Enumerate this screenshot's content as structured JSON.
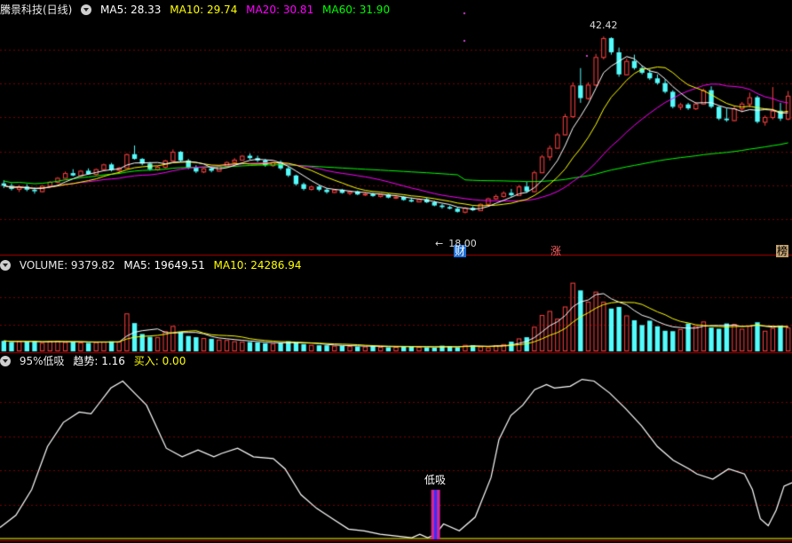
{
  "header_price": {
    "title": "騰景科技(日线)",
    "ma5": "MA5: 28.33",
    "ma10": "MA10: 29.74",
    "ma20": "MA20: 30.81",
    "ma60": "MA60: 31.90"
  },
  "header_volume": {
    "volume": "VOLUME: 9379.82",
    "ma5": "MA5: 19649.51",
    "ma10": "MA10: 24286.94"
  },
  "header_indicator": {
    "name": "95%低吸",
    "trend": "趋势: 1.16",
    "buy": "买入: 0.00"
  },
  "annotations": {
    "high_label": "42.42",
    "low_label": "18.00",
    "buy_signal": "低吸",
    "event_cai": "财",
    "event_zhang": "涨",
    "event_bang": "榜"
  },
  "colors": {
    "up": "#ff4040",
    "down": "#54fcfc",
    "ma5": "#ffffff",
    "ma10": "#ffff00",
    "ma20": "#ff00ff",
    "ma60": "#00ff00",
    "grid": "#7a0000"
  },
  "chart_data": {
    "type": "candlestick",
    "panels": [
      "price",
      "volume",
      "trend"
    ],
    "price_range": [
      15,
      45
    ],
    "candles": [
      [
        23.8,
        24.2,
        23.2,
        23.5
      ],
      [
        23.5,
        23.8,
        22.9,
        23.1
      ],
      [
        23.1,
        23.6,
        22.7,
        23.4
      ],
      [
        23.4,
        23.7,
        22.8,
        23.0
      ],
      [
        23.0,
        23.3,
        22.5,
        22.8
      ],
      [
        22.8,
        23.6,
        22.7,
        23.5
      ],
      [
        23.5,
        24.1,
        23.4,
        24.0
      ],
      [
        24.0,
        24.6,
        23.8,
        24.5
      ],
      [
        24.5,
        25.3,
        24.4,
        25.1
      ],
      [
        25.1,
        25.6,
        24.7,
        24.8
      ],
      [
        24.8,
        25.5,
        24.6,
        25.4
      ],
      [
        25.4,
        25.7,
        24.9,
        25.0
      ],
      [
        25.0,
        25.7,
        24.8,
        25.6
      ],
      [
        25.6,
        26.3,
        25.4,
        26.2
      ],
      [
        26.2,
        26.4,
        25.3,
        25.5
      ],
      [
        25.5,
        25.9,
        25.0,
        25.8
      ],
      [
        25.8,
        27.6,
        25.7,
        27.5
      ],
      [
        27.5,
        28.6,
        26.8,
        26.9
      ],
      [
        26.9,
        27.0,
        26.1,
        26.3
      ],
      [
        26.3,
        26.5,
        25.4,
        25.6
      ],
      [
        25.6,
        26.0,
        25.4,
        25.9
      ],
      [
        25.9,
        26.8,
        25.7,
        26.7
      ],
      [
        26.7,
        28.1,
        26.6,
        27.8
      ],
      [
        27.8,
        27.9,
        26.5,
        26.7
      ],
      [
        26.7,
        26.9,
        25.6,
        25.8
      ],
      [
        25.8,
        26.1,
        25.1,
        25.3
      ],
      [
        25.3,
        25.8,
        25.1,
        25.7
      ],
      [
        25.7,
        26.0,
        25.2,
        25.4
      ],
      [
        25.4,
        26.1,
        25.3,
        26.0
      ],
      [
        26.0,
        26.6,
        25.8,
        26.5
      ],
      [
        26.5,
        27.0,
        26.3,
        26.8
      ],
      [
        26.8,
        27.4,
        26.7,
        27.3
      ],
      [
        27.3,
        27.6,
        26.8,
        27.0
      ],
      [
        27.0,
        27.3,
        26.5,
        26.7
      ],
      [
        26.7,
        26.9,
        25.9,
        26.1
      ],
      [
        26.1,
        26.6,
        25.9,
        26.5
      ],
      [
        26.5,
        26.7,
        25.5,
        25.7
      ],
      [
        25.7,
        25.9,
        24.6,
        24.8
      ],
      [
        24.8,
        24.9,
        23.5,
        23.7
      ],
      [
        23.7,
        23.9,
        22.9,
        23.1
      ],
      [
        23.1,
        23.5,
        22.9,
        23.4
      ],
      [
        23.4,
        23.6,
        22.8,
        23.0
      ],
      [
        23.0,
        23.2,
        22.5,
        22.7
      ],
      [
        22.7,
        23.1,
        22.6,
        23.0
      ],
      [
        23.0,
        23.1,
        22.5,
        22.6
      ],
      [
        22.6,
        22.9,
        22.3,
        22.8
      ],
      [
        22.8,
        22.9,
        22.3,
        22.4
      ],
      [
        22.4,
        22.7,
        22.2,
        22.5
      ],
      [
        22.5,
        22.6,
        22.1,
        22.2
      ],
      [
        22.2,
        22.5,
        22.0,
        22.4
      ],
      [
        22.4,
        22.5,
        21.9,
        22.0
      ],
      [
        22.0,
        22.3,
        21.8,
        22.1
      ],
      [
        22.1,
        22.2,
        21.6,
        21.7
      ],
      [
        21.7,
        22.0,
        21.4,
        21.5
      ],
      [
        21.5,
        21.9,
        21.4,
        21.8
      ],
      [
        21.8,
        22.0,
        21.3,
        21.4
      ],
      [
        21.4,
        21.6,
        20.9,
        21.0
      ],
      [
        21.0,
        21.2,
        20.6,
        20.8
      ],
      [
        20.8,
        21.0,
        20.5,
        20.6
      ],
      [
        20.6,
        20.8,
        20.1,
        20.2
      ],
      [
        20.2,
        20.8,
        20.0,
        20.7
      ],
      [
        20.7,
        20.9,
        20.3,
        20.4
      ],
      [
        20.4,
        21.3,
        20.3,
        21.2
      ],
      [
        21.2,
        22.0,
        21.0,
        21.9
      ],
      [
        21.9,
        22.4,
        21.7,
        22.2
      ],
      [
        22.2,
        22.8,
        22.0,
        22.6
      ],
      [
        22.6,
        23.1,
        22.1,
        22.3
      ],
      [
        22.3,
        23.6,
        22.2,
        23.4
      ],
      [
        23.4,
        24.0,
        22.6,
        22.8
      ],
      [
        22.8,
        25.4,
        22.7,
        25.2
      ],
      [
        25.2,
        27.4,
        25.1,
        27.2
      ],
      [
        27.2,
        28.6,
        26.7,
        28.3
      ],
      [
        28.3,
        30.2,
        28.2,
        30.0
      ],
      [
        30.0,
        32.6,
        29.9,
        32.3
      ],
      [
        32.3,
        36.6,
        32.1,
        36.2
      ],
      [
        36.2,
        38.4,
        34.0,
        34.6
      ],
      [
        34.6,
        36.6,
        34.4,
        36.3
      ],
      [
        36.3,
        40.2,
        36.1,
        39.8
      ],
      [
        39.8,
        42.4,
        39.5,
        42.2
      ],
      [
        42.2,
        42.3,
        40.1,
        40.4
      ],
      [
        40.4,
        41.0,
        37.3,
        37.6
      ],
      [
        37.6,
        39.6,
        37.5,
        39.3
      ],
      [
        39.3,
        40.1,
        38.2,
        38.4
      ],
      [
        38.4,
        38.7,
        37.6,
        37.8
      ],
      [
        37.8,
        38.3,
        36.9,
        37.1
      ],
      [
        37.1,
        37.6,
        36.3,
        36.5
      ],
      [
        36.5,
        37.0,
        35.2,
        35.4
      ],
      [
        35.4,
        35.6,
        33.3,
        33.5
      ],
      [
        33.5,
        34.0,
        33.1,
        33.8
      ],
      [
        33.8,
        34.0,
        33.1,
        33.3
      ],
      [
        33.3,
        34.1,
        33.1,
        33.9
      ],
      [
        33.9,
        35.8,
        33.8,
        35.6
      ],
      [
        35.6,
        36.1,
        33.3,
        33.5
      ],
      [
        33.5,
        33.6,
        31.8,
        32.0
      ],
      [
        32.0,
        33.3,
        31.6,
        31.8
      ],
      [
        31.8,
        33.6,
        31.7,
        33.3
      ],
      [
        33.3,
        34.1,
        32.8,
        33.9
      ],
      [
        33.9,
        35.3,
        33.4,
        34.7
      ],
      [
        34.7,
        34.9,
        31.4,
        31.6
      ],
      [
        31.6,
        32.4,
        31.1,
        32.2
      ],
      [
        32.2,
        36.0,
        31.9,
        33.0
      ],
      [
        33.0,
        34.0,
        31.7,
        32.0
      ],
      [
        32.0,
        35.5,
        31.8,
        34.9
      ]
    ],
    "volumes": [
      2.6,
      2.3,
      2.5,
      2.4,
      2.5,
      2.1,
      2.5,
      2.6,
      2.3,
      2.4,
      2.2,
      2.1,
      2.3,
      2.4,
      2.5,
      2.4,
      9.4,
      7.0,
      4.3,
      3.6,
      3.5,
      5.0,
      6.3,
      4.8,
      3.8,
      3.5,
      3.3,
      3.1,
      2.9,
      2.8,
      2.5,
      2.4,
      2.3,
      2.2,
      2.0,
      1.9,
      2.1,
      2.5,
      2.2,
      1.8,
      1.6,
      1.5,
      1.5,
      1.4,
      1.4,
      1.3,
      1.2,
      1.2,
      1.3,
      1.1,
      1.0,
      1.1,
      1.3,
      1.2,
      1.1,
      1.0,
      0.9,
      1.4,
      1.3,
      1.0,
      1.6,
      1.5,
      1.2,
      1.0,
      1.5,
      1.8,
      2.4,
      3.2,
      3.5,
      6.1,
      9.0,
      10.0,
      8.1,
      11.1,
      17.0,
      15.1,
      12.3,
      14.8,
      12.3,
      10.6,
      11.0,
      8.9,
      7.7,
      6.5,
      7.6,
      6.2,
      5.1,
      5.0,
      5.5,
      6.9,
      6.3,
      7.4,
      5.9,
      5.6,
      6.9,
      6.8,
      5.6,
      6.3,
      7.2,
      5.1,
      5.8,
      6.4,
      5.9
    ],
    "volume_range": [
      0,
      20
    ],
    "trend_line": [
      [
        0.0,
        0.07
      ],
      [
        0.02,
        0.14
      ],
      [
        0.04,
        0.29
      ],
      [
        0.06,
        0.54
      ],
      [
        0.08,
        0.68
      ],
      [
        0.1,
        0.74
      ],
      [
        0.115,
        0.73
      ],
      [
        0.125,
        0.79
      ],
      [
        0.14,
        0.88
      ],
      [
        0.155,
        0.92
      ],
      [
        0.17,
        0.85
      ],
      [
        0.185,
        0.78
      ],
      [
        0.21,
        0.53
      ],
      [
        0.23,
        0.48
      ],
      [
        0.25,
        0.52
      ],
      [
        0.27,
        0.48
      ],
      [
        0.28,
        0.5
      ],
      [
        0.3,
        0.53
      ],
      [
        0.32,
        0.48
      ],
      [
        0.345,
        0.47
      ],
      [
        0.36,
        0.41
      ],
      [
        0.38,
        0.26
      ],
      [
        0.4,
        0.18
      ],
      [
        0.42,
        0.12
      ],
      [
        0.44,
        0.06
      ],
      [
        0.46,
        0.05
      ],
      [
        0.48,
        0.03
      ],
      [
        0.5,
        0.02
      ],
      [
        0.52,
        0.01
      ],
      [
        0.53,
        0.03
      ],
      [
        0.54,
        0.01
      ],
      [
        0.55,
        0.03
      ],
      [
        0.56,
        0.09
      ],
      [
        0.58,
        0.05
      ],
      [
        0.6,
        0.13
      ],
      [
        0.62,
        0.36
      ],
      [
        0.63,
        0.58
      ],
      [
        0.645,
        0.72
      ],
      [
        0.66,
        0.78
      ],
      [
        0.675,
        0.87
      ],
      [
        0.69,
        0.9
      ],
      [
        0.7,
        0.88
      ],
      [
        0.72,
        0.89
      ],
      [
        0.735,
        0.93
      ],
      [
        0.75,
        0.92
      ],
      [
        0.77,
        0.85
      ],
      [
        0.79,
        0.76
      ],
      [
        0.81,
        0.66
      ],
      [
        0.83,
        0.54
      ],
      [
        0.85,
        0.46
      ],
      [
        0.87,
        0.41
      ],
      [
        0.88,
        0.38
      ],
      [
        0.9,
        0.35
      ],
      [
        0.92,
        0.41
      ],
      [
        0.94,
        0.38
      ],
      [
        0.95,
        0.29
      ],
      [
        0.96,
        0.12
      ],
      [
        0.97,
        0.08
      ],
      [
        0.98,
        0.17
      ],
      [
        0.99,
        0.31
      ],
      [
        1.0,
        0.33
      ]
    ],
    "buy_signal_index": 0.55
  }
}
